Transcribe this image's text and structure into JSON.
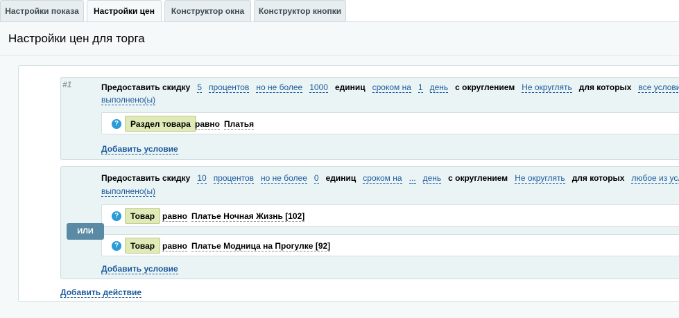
{
  "tabs": [
    "Настройки показа",
    "Настройки цен",
    "Конструктор окна",
    "Конструктор кнопки"
  ],
  "page_title": "Настройки цен для торга",
  "actions": [
    {
      "number": "#1",
      "line1": {
        "p1": "Предоставить скидку",
        "discount": "5",
        "units": "процентов",
        "max_label": "но не более",
        "max_value": "1000",
        "p2": "единиц",
        "period_label": "сроком на",
        "period_value": "1",
        "period_unit": "день",
        "p3": "с округлением",
        "rounding": "Не округлять",
        "p4": "для которых",
        "condition_mode_a": "все условия"
      },
      "line2": "выполнено(ы)",
      "conditions": [
        {
          "field": "Раздел товара",
          "op": "равно",
          "value": "Платья"
        }
      ],
      "add_condition": "Добавить условие"
    },
    {
      "number": "",
      "line1": {
        "p1": "Предоставить скидку",
        "discount": "10",
        "units": "процентов",
        "max_label": "но не более",
        "max_value": "0",
        "p2": "единиц",
        "period_label": "сроком на",
        "period_value": "...",
        "period_unit": "день",
        "p3": "с округлением",
        "rounding": "Не округлять",
        "p4": "для которых",
        "condition_mode_a": "любое из условий"
      },
      "line2": "выполнено(ы)",
      "conditions": [
        {
          "field": "Товар",
          "op": "равно",
          "value": "Платье Ночная Жизнь [102]"
        },
        {
          "field": "Товар",
          "op": "равно",
          "value": "Платье Модница на Прогулке [92]"
        }
      ],
      "or_badge": "ИЛИ",
      "add_condition": "Добавить условие"
    }
  ],
  "add_action": "Добавить действие",
  "help_glyph": "?",
  "colors": {
    "link": "#1c5a9d",
    "chip": "#dfeab7",
    "or_badge": "#5b8aa4",
    "help": "#2a9ad8"
  }
}
